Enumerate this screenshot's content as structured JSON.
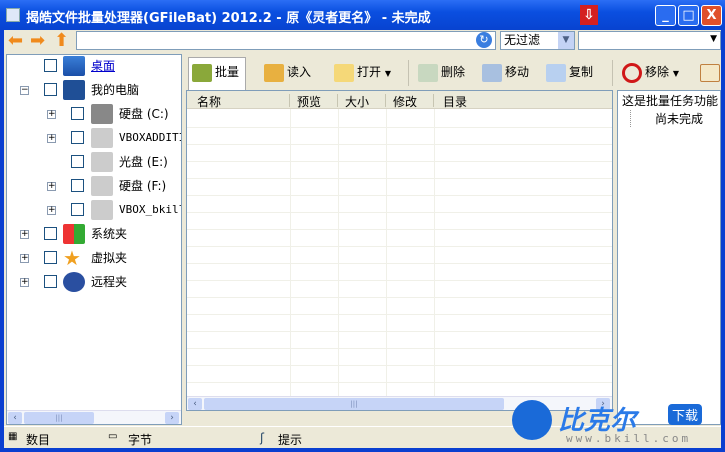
{
  "window": {
    "title": "揭皓文件批量处理器(GFileBat) 2012.2 - 原《灵者更名》 - 未完成",
    "minimize": "_",
    "maximize": "□",
    "close": "X"
  },
  "address": {
    "value": "",
    "filter": "无过滤"
  },
  "tree": [
    {
      "label": "桌面",
      "icon": "desktop-icon"
    },
    {
      "label": "我的电脑",
      "icon": "computer-icon"
    },
    {
      "label": "硬盘 (C:)",
      "icon": "drive-icon"
    },
    {
      "label": "VBOXADDITIO",
      "icon": "drive-icon"
    },
    {
      "label": "光盘 (E:)",
      "icon": "drive-icon"
    },
    {
      "label": "硬盘 (F:)",
      "icon": "drive-icon"
    },
    {
      "label": "VBOX_bkill",
      "icon": "drive-icon"
    },
    {
      "label": "系统夹",
      "icon": "windows-icon"
    },
    {
      "label": "虚拟夹",
      "icon": "star-icon"
    },
    {
      "label": "远程夹",
      "icon": "ftp-icon"
    }
  ],
  "toolbar": {
    "batch": "批量",
    "read": "读入",
    "open": "打开",
    "delete": "删除",
    "move": "移动",
    "copy": "复制",
    "remove": "移除"
  },
  "columns": [
    "名称",
    "预览",
    "大小",
    "修改",
    "目录"
  ],
  "right_panel": {
    "title": "这是批量任务功能",
    "child": "尚未完成"
  },
  "status": {
    "count": "数目",
    "bytes": "字节",
    "hint": "提示"
  },
  "watermark": {
    "brand": "比克尔",
    "download": "下载",
    "url": "www.bkill.com"
  }
}
